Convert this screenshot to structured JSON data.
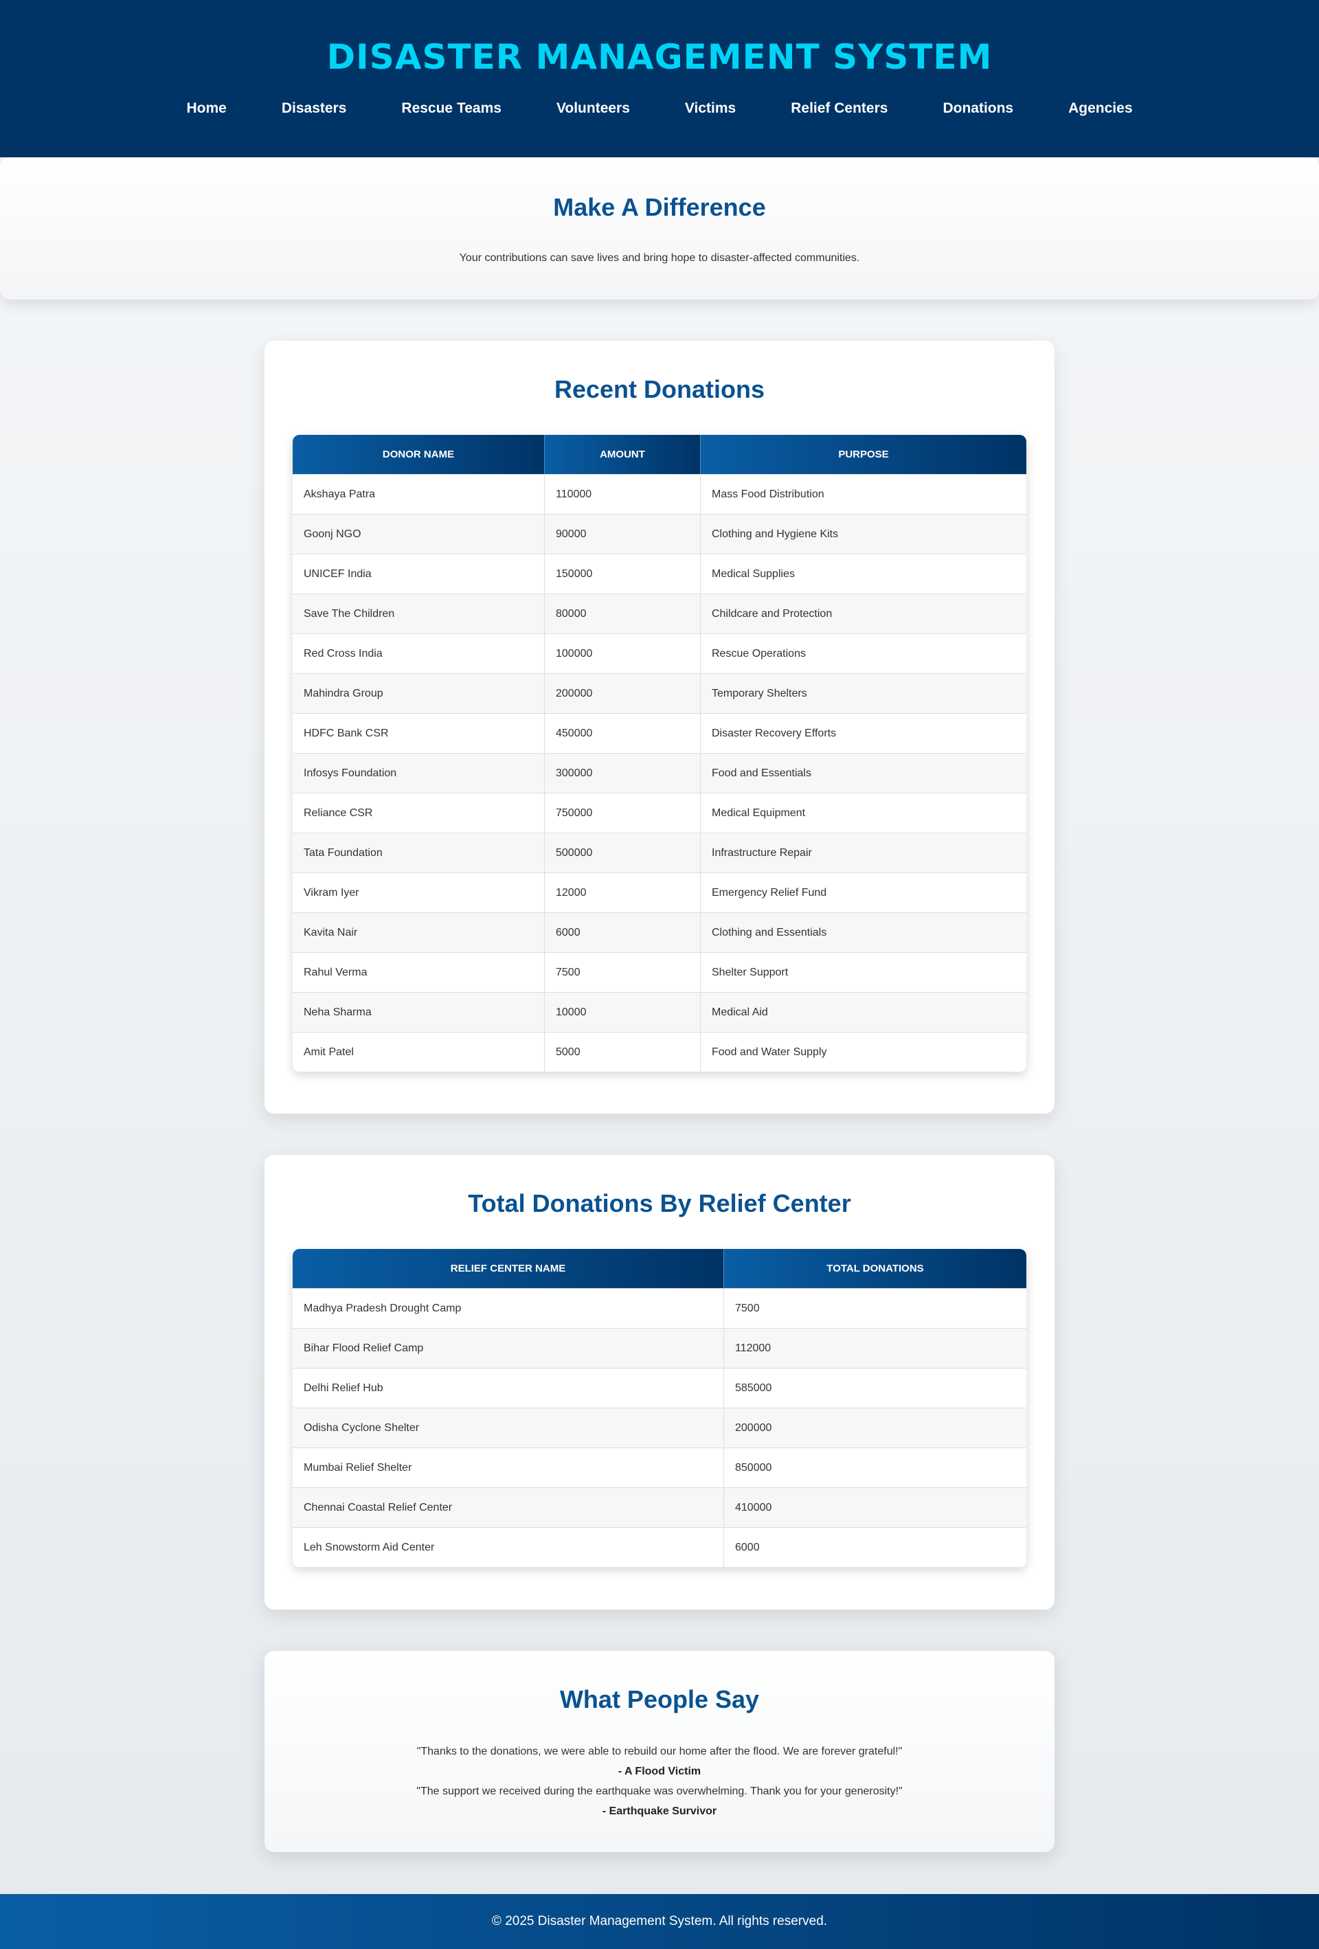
{
  "header": {
    "title": "DISASTER MANAGEMENT SYSTEM",
    "nav": [
      "Home",
      "Disasters",
      "Rescue Teams",
      "Volunteers",
      "Victims",
      "Relief Centers",
      "Donations",
      "Agencies"
    ]
  },
  "hero": {
    "heading": "Make A Difference",
    "text": "Your contributions can save lives and bring hope to disaster-affected communities."
  },
  "recent_donations": {
    "heading": "Recent Donations",
    "columns": [
      "Donor Name",
      "Amount",
      "Purpose"
    ],
    "rows": [
      [
        "Akshaya Patra",
        "110000",
        "Mass Food Distribution"
      ],
      [
        "Goonj NGO",
        "90000",
        "Clothing and Hygiene Kits"
      ],
      [
        "UNICEF India",
        "150000",
        "Medical Supplies"
      ],
      [
        "Save The Children",
        "80000",
        "Childcare and Protection"
      ],
      [
        "Red Cross India",
        "100000",
        "Rescue Operations"
      ],
      [
        "Mahindra Group",
        "200000",
        "Temporary Shelters"
      ],
      [
        "HDFC Bank CSR",
        "450000",
        "Disaster Recovery Efforts"
      ],
      [
        "Infosys Foundation",
        "300000",
        "Food and Essentials"
      ],
      [
        "Reliance CSR",
        "750000",
        "Medical Equipment"
      ],
      [
        "Tata Foundation",
        "500000",
        "Infrastructure Repair"
      ],
      [
        "Vikram Iyer",
        "12000",
        "Emergency Relief Fund"
      ],
      [
        "Kavita Nair",
        "6000",
        "Clothing and Essentials"
      ],
      [
        "Rahul Verma",
        "7500",
        "Shelter Support"
      ],
      [
        "Neha Sharma",
        "10000",
        "Medical Aid"
      ],
      [
        "Amit Patel",
        "5000",
        "Food and Water Supply"
      ]
    ]
  },
  "center_totals": {
    "heading": "Total Donations By Relief Center",
    "columns": [
      "Relief Center Name",
      "Total Donations"
    ],
    "rows": [
      [
        "Madhya Pradesh Drought Camp",
        "7500"
      ],
      [
        "Bihar Flood Relief Camp",
        "112000"
      ],
      [
        "Delhi Relief Hub",
        "585000"
      ],
      [
        "Odisha Cyclone Shelter",
        "200000"
      ],
      [
        "Mumbai Relief Shelter",
        "850000"
      ],
      [
        "Chennai Coastal Relief Center",
        "410000"
      ],
      [
        "Leh Snowstorm Aid Center",
        "6000"
      ]
    ]
  },
  "testimonials": {
    "heading": "What People Say",
    "items": [
      {
        "quote": "\"Thanks to the donations, we were able to rebuild our home after the flood. We are forever grateful!\"",
        "author": "- A Flood Victim"
      },
      {
        "quote": "\"The support we received during the earthquake was overwhelming. Thank you for your generosity!\"",
        "author": "- Earthquake Survivor"
      }
    ]
  },
  "footer": {
    "text": "© 2025 Disaster Management System. All rights reserved."
  },
  "colors": {
    "header_bg": "#003366",
    "title": "#00d4f5",
    "heading": "#0a5291",
    "table_header_start": "#0a5ea5",
    "table_header_end": "#003366"
  }
}
